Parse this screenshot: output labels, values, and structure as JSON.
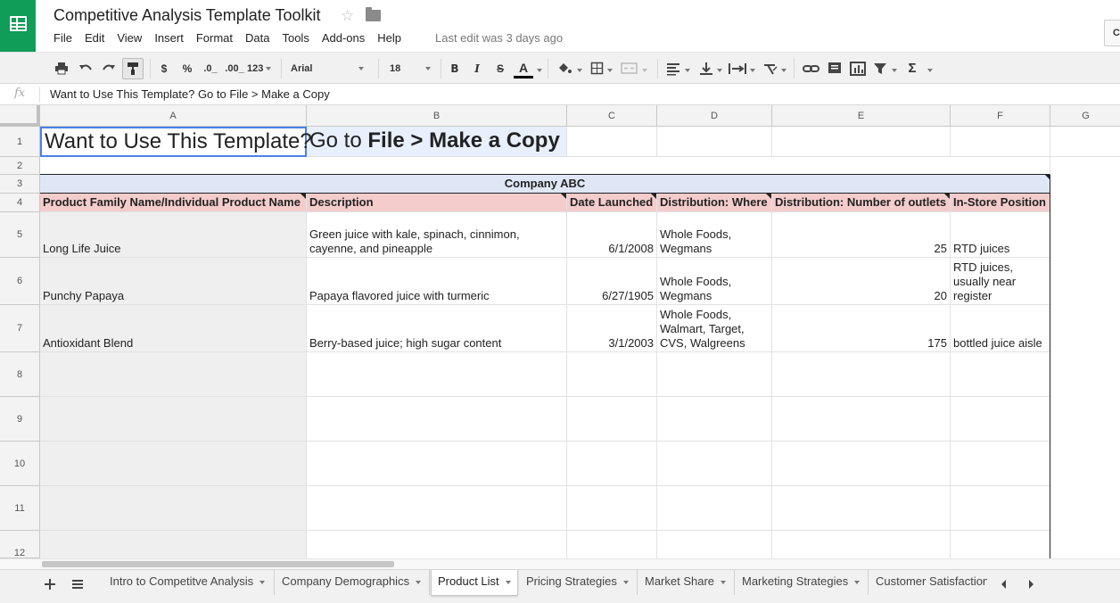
{
  "header": {
    "title": "Competitive Analysis Template Toolkit",
    "star_icon": "star-icon",
    "folder_icon": "folder-icon",
    "last_edit": "Last edit was 3 days ago",
    "share_stub": "C"
  },
  "menu": [
    "File",
    "Edit",
    "View",
    "Insert",
    "Format",
    "Data",
    "Tools",
    "Add-ons",
    "Help"
  ],
  "toolbar": {
    "currency": "$",
    "percent": "%",
    "decrease_decimal": ".0_",
    "increase_decimal": ".00_",
    "more_formats": "123",
    "font": "Arial",
    "font_size": "18",
    "bold": "B",
    "italic": "I",
    "strike": "S",
    "text_color": "A",
    "sum": "Σ"
  },
  "formula_bar": {
    "fx": "fx",
    "content": "Want to Use This Template? Go to File > Make a Copy"
  },
  "columns": [
    "A",
    "B",
    "C",
    "D",
    "E",
    "F",
    "G"
  ],
  "rows": [
    "1",
    "2",
    "3",
    "4",
    "5",
    "6",
    "7",
    "8",
    "9",
    "10",
    "11",
    "12"
  ],
  "sheet": {
    "banner_a": "Want to Use This Template?",
    "banner_b_plain": "Go to ",
    "banner_b_bold": "File > Make a Copy",
    "company": "Company ABC",
    "headers": [
      "Product Family Name/Individual Product Name",
      "Description",
      "Date Launched",
      "Distribution: Where",
      "Distribution: Number of outlets",
      "In-Store Position"
    ],
    "products": [
      {
        "name": "Long Life Juice",
        "description": "Green juice with kale, spinach, cinnimon,\ncayenne, and pineapple",
        "date": "6/1/2008",
        "where": "Whole Foods,\nWegmans",
        "outlets": "25",
        "position": "RTD juices"
      },
      {
        "name": "Punchy Papaya",
        "description": "Papaya flavored juice with turmeric",
        "date": "6/27/1905",
        "where": "Whole Foods,\nWegmans",
        "outlets": "20",
        "position": "RTD juices,\nusually near\nregister"
      },
      {
        "name": "Antioxidant Blend",
        "description": "Berry-based juice; high sugar content",
        "date": "3/1/2003",
        "where": "Whole Foods,\nWalmart, Target,\nCVS, Walgreens",
        "outlets": "175",
        "position": "bottled juice aisle"
      }
    ]
  },
  "tabs": [
    "Intro to Competitve Analysis",
    "Company Demographics",
    "Product List",
    "Pricing Strategies",
    "Market Share",
    "Marketing Strategies",
    "Customer Satisfaction"
  ],
  "active_tab": "Product List",
  "colors": {
    "brand_green": "#0f9d58",
    "header_pink": "#f4cccc",
    "company_blue": "#dfe7f6",
    "gray_column": "#efefef"
  }
}
